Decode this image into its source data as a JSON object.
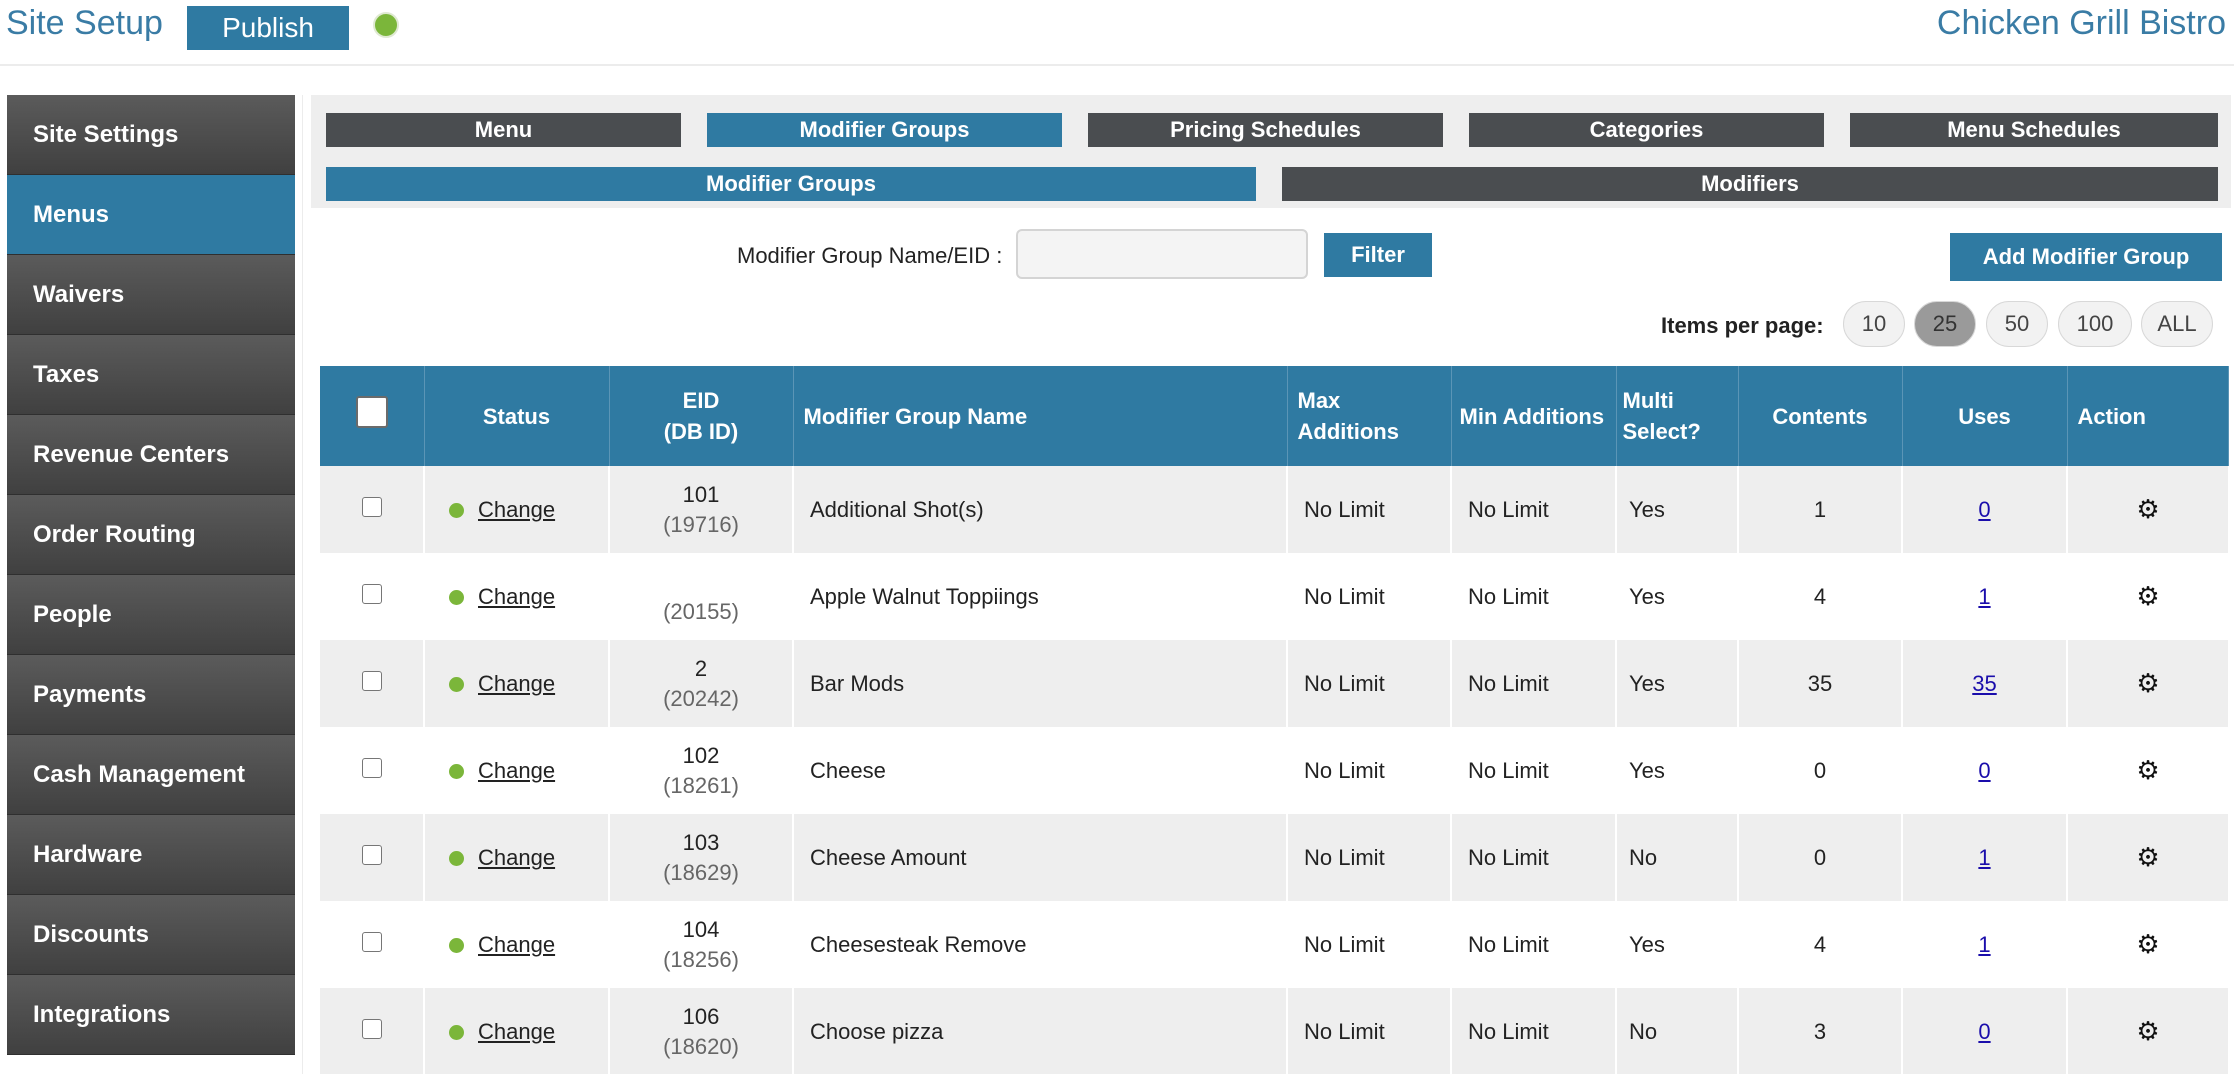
{
  "header": {
    "title": "Site Setup",
    "publish_label": "Publish",
    "restaurant": "Chicken Grill Bistro"
  },
  "sidebar": {
    "items": [
      {
        "label": "Site Settings"
      },
      {
        "label": "Menus"
      },
      {
        "label": "Waivers"
      },
      {
        "label": "Taxes"
      },
      {
        "label": "Revenue Centers"
      },
      {
        "label": "Order Routing"
      },
      {
        "label": "People"
      },
      {
        "label": "Payments"
      },
      {
        "label": "Cash Management"
      },
      {
        "label": "Hardware"
      },
      {
        "label": "Discounts"
      },
      {
        "label": "Integrations"
      }
    ],
    "active": "Menus"
  },
  "tabs": [
    {
      "label": "Menu"
    },
    {
      "label": "Modifier Groups"
    },
    {
      "label": "Pricing Schedules"
    },
    {
      "label": "Categories"
    },
    {
      "label": "Menu Schedules"
    }
  ],
  "subtabs": [
    {
      "label": "Modifier Groups"
    },
    {
      "label": "Modifiers"
    }
  ],
  "filter": {
    "label": "Modifier Group Name/EID :",
    "value": "",
    "button": "Filter"
  },
  "add_button": "Add Modifier Group",
  "items_per_page": {
    "label": "Items per page:",
    "options": [
      "10",
      "25",
      "50",
      "100",
      "ALL"
    ],
    "selected": "25"
  },
  "table": {
    "headers": {
      "status": "Status",
      "eid": "EID",
      "dbid": "(DB ID)",
      "name": "Modifier Group Name",
      "max": "Max",
      "max2": "Additions",
      "min": "Min Additions",
      "multi": "Multi",
      "multi2": "Select?",
      "contents": "Contents",
      "uses": "Uses",
      "action": "Action"
    },
    "rows": [
      {
        "status": "Change",
        "eid": "101",
        "dbid": "(19716)",
        "name": "Additional Shot(s)",
        "max": "No Limit",
        "min": "No Limit",
        "multi": "Yes",
        "contents": "1",
        "uses": "0"
      },
      {
        "status": "Change",
        "eid": "",
        "dbid": "(20155)",
        "name": "Apple Walnut Toppiings",
        "max": "No Limit",
        "min": "No Limit",
        "multi": "Yes",
        "contents": "4",
        "uses": "1"
      },
      {
        "status": "Change",
        "eid": "2",
        "dbid": "(20242)",
        "name": "Bar Mods",
        "max": "No Limit",
        "min": "No Limit",
        "multi": "Yes",
        "contents": "35",
        "uses": "35"
      },
      {
        "status": "Change",
        "eid": "102",
        "dbid": "(18261)",
        "name": "Cheese",
        "max": "No Limit",
        "min": "No Limit",
        "multi": "Yes",
        "contents": "0",
        "uses": "0"
      },
      {
        "status": "Change",
        "eid": "103",
        "dbid": "(18629)",
        "name": "Cheese Amount",
        "max": "No Limit",
        "min": "No Limit",
        "multi": "No",
        "contents": "0",
        "uses": "1"
      },
      {
        "status": "Change",
        "eid": "104",
        "dbid": "(18256)",
        "name": "Cheesesteak Remove",
        "max": "No Limit",
        "min": "No Limit",
        "multi": "Yes",
        "contents": "4",
        "uses": "1"
      },
      {
        "status": "Change",
        "eid": "106",
        "dbid": "(18620)",
        "name": "Choose pizza",
        "max": "No Limit",
        "min": "No Limit",
        "multi": "No",
        "contents": "3",
        "uses": "0"
      }
    ]
  },
  "colors": {
    "accent": "#2f7aa2",
    "tab_dark": "#4a4d50",
    "status_green": "#7bb63a",
    "row_alt": "#eeeeee"
  },
  "icons": {
    "status": "green-dot-icon",
    "action": "gear-icon"
  }
}
